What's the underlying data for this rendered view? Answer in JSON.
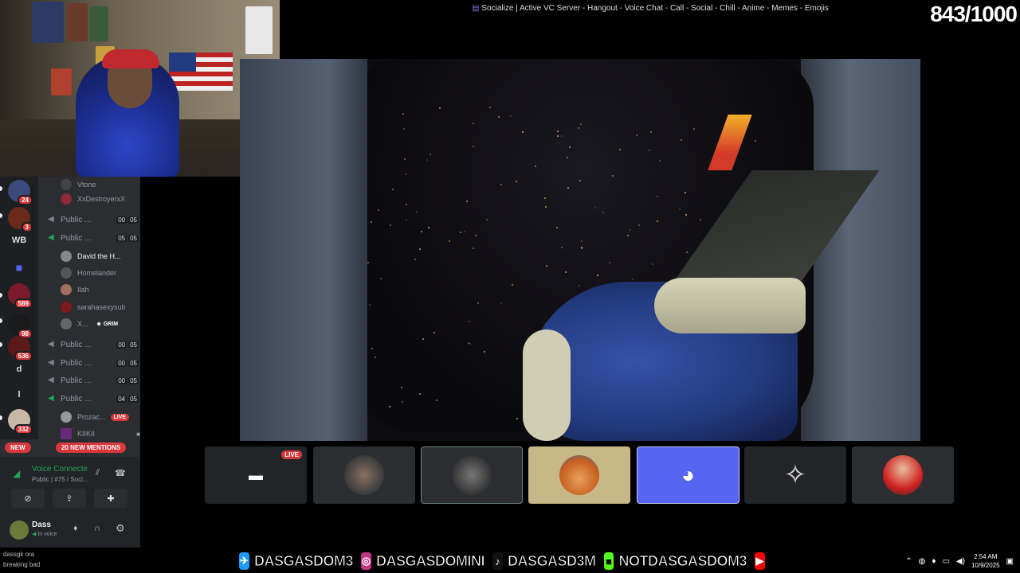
{
  "stream_counter": "843/1000",
  "server_header": {
    "icon": "server-emoji-icon",
    "title": "Socialize | Active VC Server - Hangout - Voice Chat - Call - Social - Chill - Anime - Memes - Emojis"
  },
  "server_rail": [
    {
      "label": "",
      "badge": "24"
    },
    {
      "label": "",
      "badge": "3"
    },
    {
      "label": "WB",
      "badge": ""
    },
    {
      "label": "",
      "badge": ""
    },
    {
      "label": "",
      "badge": "589"
    },
    {
      "label": "",
      "badge": "98"
    },
    {
      "label": "",
      "badge": "536"
    },
    {
      "label": "d",
      "badge": ""
    },
    {
      "label": "l",
      "badge": ""
    },
    {
      "label": "",
      "badge": "332"
    }
  ],
  "new_badge": "NEW",
  "mentions_badge": "20 NEW MENTIONS",
  "channels": {
    "top_members": [
      {
        "name": "Vtone"
      },
      {
        "name": "XxDestroyerxX"
      }
    ],
    "voice_1": {
      "name": "Public ...",
      "count_a": "00",
      "count_b": "05"
    },
    "voice_2": {
      "name": "Public ...",
      "count_a": "05",
      "count_b": "05"
    },
    "voice_2_members": [
      {
        "name": "David the H..."
      },
      {
        "name": "Homelander"
      },
      {
        "name": "Ilah"
      },
      {
        "name": "sarahasexysub"
      },
      {
        "name": "X...",
        "tag": "GRIM"
      }
    ],
    "voice_3": {
      "name": "Public ...",
      "count_a": "00",
      "count_b": "05"
    },
    "voice_4": {
      "name": "Public ...",
      "count_a": "00",
      "count_b": "05"
    },
    "voice_5": {
      "name": "Public ...",
      "count_a": "00",
      "count_b": "05"
    },
    "voice_6": {
      "name": "Public ...",
      "count_a": "04",
      "count_b": "05"
    },
    "voice_6_members": [
      {
        "name": "Prozac...",
        "live": "LIVE"
      },
      {
        "name": "KIIKII"
      }
    ]
  },
  "voice_panel": {
    "status": "Voice Connecte",
    "channel": "Public | #75 / Soci...",
    "user_name": "Dass",
    "user_status": "In voice"
  },
  "tiles": [
    {
      "kind": "screen",
      "live": "LIVE"
    },
    {
      "kind": "avatar"
    },
    {
      "kind": "avatar"
    },
    {
      "kind": "avatar"
    },
    {
      "kind": "discord"
    },
    {
      "kind": "avatar"
    },
    {
      "kind": "avatar"
    }
  ],
  "chat_overlay": {
    "line1": "dassgk ora",
    "line2": "breaking bad"
  },
  "socials": [
    {
      "icon": "twitter-icon",
      "handle": "DASGASDOM3"
    },
    {
      "icon": "instagram-icon",
      "handle": "DASGASDOMINI"
    },
    {
      "icon": "tiktok-icon",
      "handle": "DASGASD3M"
    },
    {
      "icon": "youtube-icon",
      "handle": "NOTDASGASDOM3"
    }
  ],
  "taskbar": {
    "time": "2:54 AM",
    "date": "10/9/2025"
  },
  "colors": {
    "discord_blurple": "#5865f2",
    "live_red": "#da373c",
    "voice_green": "#23a55a"
  }
}
